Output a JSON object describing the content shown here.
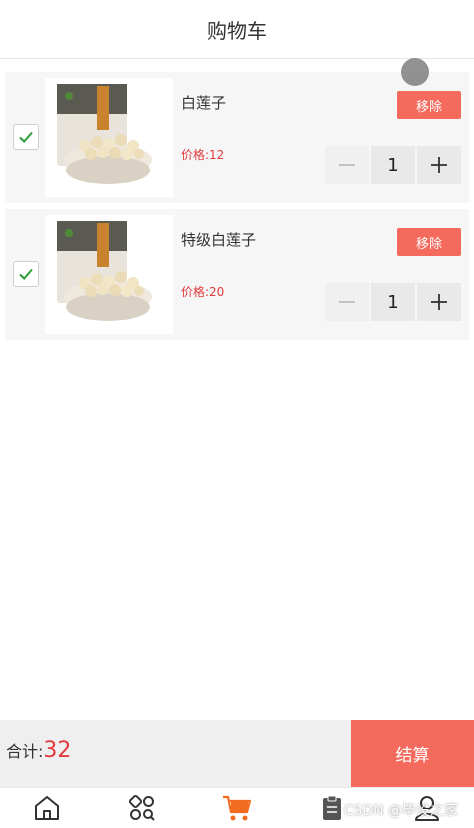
{
  "header": {
    "title": "购物车"
  },
  "cart": {
    "items": [
      {
        "name": "白莲子",
        "price_label": "价格:12",
        "remove_label": "移除",
        "minus_symbol": "−",
        "plus_symbol": "+",
        "quantity": "1",
        "checked": true
      },
      {
        "name": "特级白莲子",
        "price_label": "价格:20",
        "remove_label": "移除",
        "minus_symbol": "−",
        "plus_symbol": "+",
        "quantity": "1",
        "checked": true
      }
    ]
  },
  "footer": {
    "total_label": "合计:",
    "total_value": "32",
    "checkout_label": "结算"
  },
  "tabbar": {
    "tabs": [
      {
        "icon": "home-icon",
        "active": false
      },
      {
        "icon": "category-icon",
        "active": false
      },
      {
        "icon": "cart-icon",
        "active": true
      },
      {
        "icon": "orders-icon",
        "active": false
      },
      {
        "icon": "user-icon",
        "active": false
      }
    ]
  },
  "watermark": "CSDN @毕设之家",
  "colors": {
    "accent": "#f46b5e",
    "price": "#e4393c",
    "check": "#2e9e3a",
    "active_tab": "#f26b21"
  }
}
